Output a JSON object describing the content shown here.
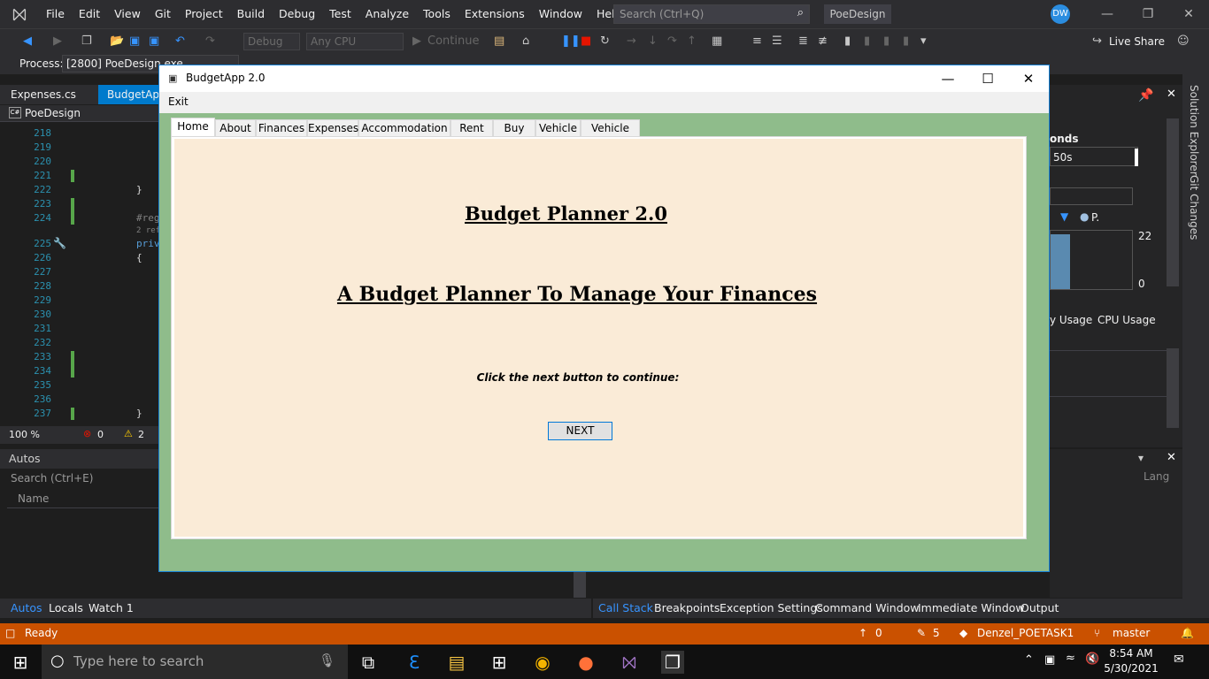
{
  "ide": {
    "menu": [
      "File",
      "Edit",
      "View",
      "Git",
      "Project",
      "Build",
      "Debug",
      "Test",
      "Analyze",
      "Tools",
      "Extensions",
      "Window",
      "Help"
    ],
    "search_placeholder": "Search (Ctrl+Q)",
    "solution_name": "PoeDesign",
    "avatar_initials": "DW",
    "toolbar": {
      "config": "Debug",
      "platform": "Any CPU",
      "continue": "Continue",
      "live_share": "Live Share"
    },
    "process": {
      "label": "Process:",
      "value": "[2800] PoeDesign.exe"
    },
    "doc_tabs": [
      "Expenses.cs",
      "BudgetApp"
    ],
    "project_label": "PoeDesign",
    "line_numbers": [
      "218",
      "219",
      "220",
      "221",
      "222",
      "223",
      "224",
      "225",
      "226",
      "227",
      "228",
      "229",
      "230",
      "231",
      "232",
      "233",
      "234",
      "235",
      "236",
      "237"
    ],
    "code": {
      "brace_close": "}",
      "region": "#reg",
      "refs": "2 refe",
      "private": "priv",
      "brace_open": "{",
      "brace_close2": "}"
    },
    "zoom": "100 %",
    "errors": "0",
    "warnings": "2",
    "autos": {
      "title": "Autos",
      "search_placeholder": "Search (Ctrl+E)",
      "column_name": "Name"
    },
    "bottom_tabs_left": [
      "Autos",
      "Locals",
      "Watch 1"
    ],
    "bottom_tabs_right": [
      "Call Stack",
      "Breakpoints",
      "Exception Settings",
      "Command Window",
      "Immediate Window",
      "Output"
    ],
    "diag": {
      "seconds": "onds",
      "time": "50s",
      "tick_top": "22",
      "tick_bottom": "0",
      "legend_p": "P.",
      "tab_memory": "y Usage",
      "tab_cpu": "CPU Usage",
      "lang": "Lang"
    },
    "side_tabs": [
      "Solution Explorer",
      "Git Changes"
    ],
    "status": {
      "ready": "Ready",
      "up": "0",
      "edits": "5",
      "repo": "Denzel_POETASK1",
      "branch": "master"
    }
  },
  "taskbar": {
    "search_placeholder": "Type here to search",
    "time": "8:54 AM",
    "date": "5/30/2021"
  },
  "app": {
    "title": "BudgetApp 2.0",
    "menu_exit": "Exit",
    "tabs": [
      "Home",
      "About",
      "Finances",
      "Expenses",
      "Accommodation",
      "Rent",
      "Buy",
      "Vehicle",
      "Vehicle Buy"
    ],
    "heading": "Budget Planner 2.0",
    "subheading": "A Budget Planner To Manage Your Finances",
    "instruction": "Click the next button to continue:",
    "next_button": "NEXT",
    "colors": {
      "background": "#8fbc8b",
      "page": "#faebd7",
      "button_border": "#0078d7"
    }
  }
}
